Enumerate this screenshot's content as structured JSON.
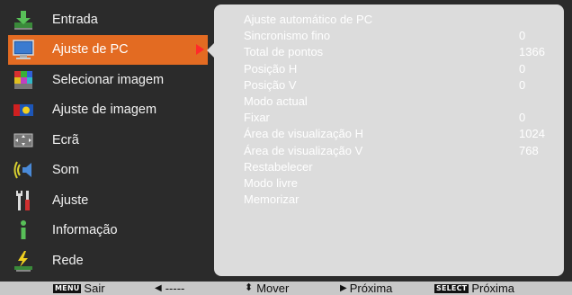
{
  "menu": {
    "items": [
      {
        "label": "Entrada",
        "icon": "input-icon"
      },
      {
        "label": "Ajuste de PC",
        "icon": "pc-adjust-icon",
        "selected": true
      },
      {
        "label": "Selecionar imagem",
        "icon": "image-select-icon"
      },
      {
        "label": "Ajuste de imagem",
        "icon": "image-adjust-icon"
      },
      {
        "label": "Ecrã",
        "icon": "screen-icon"
      },
      {
        "label": "Som",
        "icon": "sound-icon"
      },
      {
        "label": "Ajuste",
        "icon": "setting-icon"
      },
      {
        "label": "Informação",
        "icon": "info-icon"
      },
      {
        "label": "Rede",
        "icon": "network-icon"
      }
    ]
  },
  "panel": {
    "rows": [
      {
        "label": "Ajuste automático de PC",
        "value": ""
      },
      {
        "label": "Sincronismo fino",
        "value": "0"
      },
      {
        "label": "Total de pontos",
        "value": "1366"
      },
      {
        "label": "Posição H",
        "value": "0"
      },
      {
        "label": "Posição V",
        "value": "0"
      },
      {
        "label": "Modo actual",
        "value": ""
      },
      {
        "label": "Fixar",
        "value": "0"
      },
      {
        "label": "Área de visualização H",
        "value": "1024"
      },
      {
        "label": "Área de visualização V",
        "value": "768"
      },
      {
        "label": "Restabelecer",
        "value": ""
      },
      {
        "label": "Modo livre",
        "value": ""
      },
      {
        "label": "Memorizar",
        "value": ""
      }
    ]
  },
  "statusbar": {
    "menu_key": "MENU",
    "exit_label": "Sair",
    "back_label": "-----",
    "move_label": "Mover",
    "next_label": "Próxima",
    "select_key": "SELECT",
    "select_label": "Próxima"
  },
  "colors": {
    "background": "#2b2b2b",
    "selected": "#e36b22",
    "panel": "#dcdcdc",
    "arrow": "#ff2a2a"
  }
}
